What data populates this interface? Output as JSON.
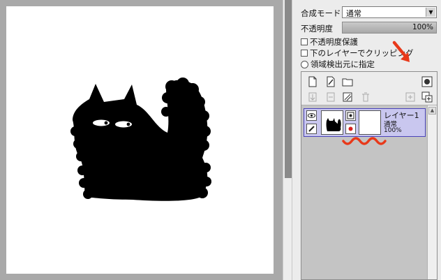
{
  "panel": {
    "blend_label": "合成モード",
    "blend_value": "通常",
    "opacity_label": "不透明度",
    "opacity_value": "100%",
    "opacity_fraction": 1.0,
    "options": [
      {
        "type": "checkbox",
        "label": "不透明度保護",
        "checked": false
      },
      {
        "type": "checkbox",
        "label": "下のレイヤーでクリッピング",
        "checked": false
      },
      {
        "type": "radio",
        "label": "領域検出元に指定",
        "checked": false
      }
    ]
  },
  "layers": [
    {
      "name": "レイヤー1",
      "mode": "通常",
      "opacity": "100%",
      "visible": true,
      "selected": true
    }
  ],
  "icons": {
    "new_layer": "new-layer-icon",
    "new_vector_layer": "new-vector-layer-icon",
    "new_folder": "new-folder-icon",
    "layer_mask": "layer-mask-icon",
    "merge_down": "merge-down-icon",
    "clear": "clear-layer-icon",
    "delete": "delete-layer-icon"
  },
  "colors": {
    "selection": "#c9c7ef",
    "selection_border": "#4a43b8",
    "annotation": "#e8391a"
  }
}
